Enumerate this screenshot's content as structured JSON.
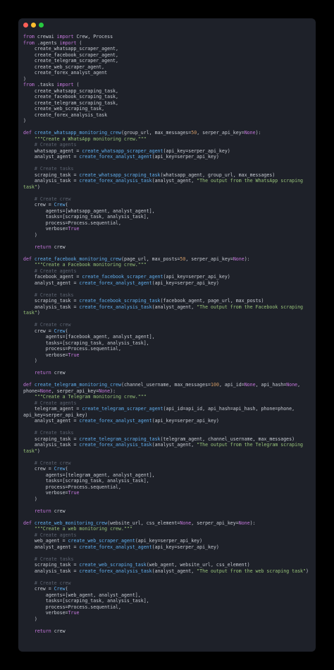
{
  "window": {
    "buttons": [
      {
        "name": "close",
        "color": "#ff5f56"
      },
      {
        "name": "minimize",
        "color": "#ffbd2e"
      },
      {
        "name": "maximize",
        "color": "#27c93f"
      }
    ]
  },
  "theme": {
    "background": "#1e2129",
    "page_background": "#000000",
    "keyword": "#c678dd",
    "function": "#61afef",
    "string": "#98c379",
    "number": "#d19a66",
    "comment": "#5c6370",
    "plain": "#c6cad2"
  },
  "code_lines": [
    [
      [
        "kw",
        "from"
      ],
      [
        "pl",
        " crewai "
      ],
      [
        "kw",
        "import"
      ],
      [
        "pl",
        " Crew, Process"
      ]
    ],
    [
      [
        "kw",
        "from"
      ],
      [
        "pl",
        " .agents "
      ],
      [
        "kw",
        "import"
      ],
      [
        "pl",
        " ("
      ]
    ],
    [
      [
        "pl",
        "    create_whatsapp_scraper_agent,"
      ]
    ],
    [
      [
        "pl",
        "    create_facebook_scraper_agent,"
      ]
    ],
    [
      [
        "pl",
        "    create_telegram_scraper_agent,"
      ]
    ],
    [
      [
        "pl",
        "    create_web_scraper_agent,"
      ]
    ],
    [
      [
        "pl",
        "    create_forex_analyst_agent"
      ]
    ],
    [
      [
        "pl",
        ")"
      ]
    ],
    [
      [
        "kw",
        "from"
      ],
      [
        "pl",
        " .tasks "
      ],
      [
        "kw",
        "import"
      ],
      [
        "pl",
        " ("
      ]
    ],
    [
      [
        "pl",
        "    create_whatsapp_scraping_task,"
      ]
    ],
    [
      [
        "pl",
        "    create_facebook_scraping_task,"
      ]
    ],
    [
      [
        "pl",
        "    create_telegram_scraping_task,"
      ]
    ],
    [
      [
        "pl",
        "    create_web_scraping_task,"
      ]
    ],
    [
      [
        "pl",
        "    create_forex_analysis_task"
      ]
    ],
    [
      [
        "pl",
        ")"
      ]
    ],
    [],
    [
      [
        "kw",
        "def"
      ],
      [
        "pl",
        " "
      ],
      [
        "fn",
        "create_whatsapp_monitoring_crew"
      ],
      [
        "pl",
        "(group_url, max_messages="
      ],
      [
        "num",
        "50"
      ],
      [
        "pl",
        ", serper_api_key="
      ],
      [
        "kw",
        "None"
      ],
      [
        "pl",
        "):"
      ]
    ],
    [
      [
        "pl",
        "    "
      ],
      [
        "str",
        "\"\"\"Create a WhatsApp monitoring crew.\"\"\""
      ]
    ],
    [
      [
        "pl",
        "    "
      ],
      [
        "cm",
        "# Create agents"
      ]
    ],
    [
      [
        "pl",
        "    whatsapp_agent = "
      ],
      [
        "fn",
        "create_whatsapp_scraper_agent"
      ],
      [
        "pl",
        "(api_key=serper_api_key)"
      ]
    ],
    [
      [
        "pl",
        "    analyst_agent = "
      ],
      [
        "fn",
        "create_forex_analyst_agent"
      ],
      [
        "pl",
        "(api_key=serper_api_key)"
      ]
    ],
    [],
    [
      [
        "pl",
        "    "
      ],
      [
        "cm",
        "# Create tasks"
      ]
    ],
    [
      [
        "pl",
        "    scraping_task = "
      ],
      [
        "fn",
        "create_whatsapp_scraping_task"
      ],
      [
        "pl",
        "(whatsapp_agent, group_url, max_messages)"
      ]
    ],
    [
      [
        "pl",
        "    analysis_task = "
      ],
      [
        "fn",
        "create_forex_analysis_task"
      ],
      [
        "pl",
        "(analyst_agent, "
      ],
      [
        "str",
        "\"The output from the WhatsApp scraping"
      ]
    ],
    [
      [
        "str",
        "task\""
      ],
      [
        "pl",
        ")"
      ]
    ],
    [],
    [
      [
        "pl",
        "    "
      ],
      [
        "cm",
        "# Create crew"
      ]
    ],
    [
      [
        "pl",
        "    crew = "
      ],
      [
        "fn",
        "Crew"
      ],
      [
        "pl",
        "("
      ]
    ],
    [
      [
        "pl",
        "        agents=[whatsapp_agent, analyst_agent],"
      ]
    ],
    [
      [
        "pl",
        "        tasks=[scraping_task, analysis_task],"
      ]
    ],
    [
      [
        "pl",
        "        process=Process.sequential,"
      ]
    ],
    [
      [
        "pl",
        "        verbose="
      ],
      [
        "kw",
        "True"
      ]
    ],
    [
      [
        "pl",
        "    )"
      ]
    ],
    [],
    [
      [
        "pl",
        "    "
      ],
      [
        "kw",
        "return"
      ],
      [
        "pl",
        " crew"
      ]
    ],
    [],
    [
      [
        "kw",
        "def"
      ],
      [
        "pl",
        " "
      ],
      [
        "fn",
        "create_facebook_monitoring_crew"
      ],
      [
        "pl",
        "(page_url, max_posts="
      ],
      [
        "num",
        "50"
      ],
      [
        "pl",
        ", serper_api_key="
      ],
      [
        "kw",
        "None"
      ],
      [
        "pl",
        "):"
      ]
    ],
    [
      [
        "pl",
        "    "
      ],
      [
        "str",
        "\"\"\"Create a Facebook monitoring crew.\"\"\""
      ]
    ],
    [
      [
        "pl",
        "    "
      ],
      [
        "cm",
        "# Create agents"
      ]
    ],
    [
      [
        "pl",
        "    facebook_agent = "
      ],
      [
        "fn",
        "create_facebook_scraper_agent"
      ],
      [
        "pl",
        "(api_key=serper_api_key)"
      ]
    ],
    [
      [
        "pl",
        "    analyst_agent = "
      ],
      [
        "fn",
        "create_forex_analyst_agent"
      ],
      [
        "pl",
        "(api_key=serper_api_key)"
      ]
    ],
    [],
    [
      [
        "pl",
        "    "
      ],
      [
        "cm",
        "# Create tasks"
      ]
    ],
    [
      [
        "pl",
        "    scraping_task = "
      ],
      [
        "fn",
        "create_facebook_scraping_task"
      ],
      [
        "pl",
        "(facebook_agent, page_url, max_posts)"
      ]
    ],
    [
      [
        "pl",
        "    analysis_task = "
      ],
      [
        "fn",
        "create_forex_analysis_task"
      ],
      [
        "pl",
        "(analyst_agent, "
      ],
      [
        "str",
        "\"The output from the Facebook scraping"
      ]
    ],
    [
      [
        "str",
        "task\""
      ],
      [
        "pl",
        ")"
      ]
    ],
    [],
    [
      [
        "pl",
        "    "
      ],
      [
        "cm",
        "# Create crew"
      ]
    ],
    [
      [
        "pl",
        "    crew = "
      ],
      [
        "fn",
        "Crew"
      ],
      [
        "pl",
        "("
      ]
    ],
    [
      [
        "pl",
        "        agents=[facebook_agent, analyst_agent],"
      ]
    ],
    [
      [
        "pl",
        "        tasks=[scraping_task, analysis_task],"
      ]
    ],
    [
      [
        "pl",
        "        process=Process.sequential,"
      ]
    ],
    [
      [
        "pl",
        "        verbose="
      ],
      [
        "kw",
        "True"
      ]
    ],
    [
      [
        "pl",
        "    )"
      ]
    ],
    [],
    [
      [
        "pl",
        "    "
      ],
      [
        "kw",
        "return"
      ],
      [
        "pl",
        " crew"
      ]
    ],
    [],
    [
      [
        "kw",
        "def"
      ],
      [
        "pl",
        " "
      ],
      [
        "fn",
        "create_telegram_monitoring_crew"
      ],
      [
        "pl",
        "(channel_username, max_messages="
      ],
      [
        "num",
        "100"
      ],
      [
        "pl",
        ", api_id="
      ],
      [
        "kw",
        "None"
      ],
      [
        "pl",
        ", api_hash="
      ],
      [
        "kw",
        "None"
      ],
      [
        "pl",
        ","
      ]
    ],
    [
      [
        "pl",
        "phone="
      ],
      [
        "kw",
        "None"
      ],
      [
        "pl",
        ", serper_api_key="
      ],
      [
        "kw",
        "None"
      ],
      [
        "pl",
        "):"
      ]
    ],
    [
      [
        "pl",
        "    "
      ],
      [
        "str",
        "\"\"\"Create a Telegram monitoring crew.\"\"\""
      ]
    ],
    [
      [
        "pl",
        "    "
      ],
      [
        "cm",
        "# Create agents"
      ]
    ],
    [
      [
        "pl",
        "    telegram_agent = "
      ],
      [
        "fn",
        "create_telegram_scraper_agent"
      ],
      [
        "pl",
        "(api_id=api_id, api_hash=api_hash, phone=phone,"
      ]
    ],
    [
      [
        "pl",
        "api_key=serper_api_key)"
      ]
    ],
    [
      [
        "pl",
        "    analyst_agent = "
      ],
      [
        "fn",
        "create_forex_analyst_agent"
      ],
      [
        "pl",
        "(api_key=serper_api_key)"
      ]
    ],
    [],
    [
      [
        "pl",
        "    "
      ],
      [
        "cm",
        "# Create tasks"
      ]
    ],
    [
      [
        "pl",
        "    scraping_task = "
      ],
      [
        "fn",
        "create_telegram_scraping_task"
      ],
      [
        "pl",
        "(telegram_agent, channel_username, max_messages)"
      ]
    ],
    [
      [
        "pl",
        "    analysis_task = "
      ],
      [
        "fn",
        "create_forex_analysis_task"
      ],
      [
        "pl",
        "(analyst_agent, "
      ],
      [
        "str",
        "\"The output from the Telegram scraping"
      ]
    ],
    [
      [
        "str",
        "task\""
      ],
      [
        "pl",
        ")"
      ]
    ],
    [],
    [
      [
        "pl",
        "    "
      ],
      [
        "cm",
        "# Create crew"
      ]
    ],
    [
      [
        "pl",
        "    crew = "
      ],
      [
        "fn",
        "Crew"
      ],
      [
        "pl",
        "("
      ]
    ],
    [
      [
        "pl",
        "        agents=[telegram_agent, analyst_agent],"
      ]
    ],
    [
      [
        "pl",
        "        tasks=[scraping_task, analysis_task],"
      ]
    ],
    [
      [
        "pl",
        "        process=Process.sequential,"
      ]
    ],
    [
      [
        "pl",
        "        verbose="
      ],
      [
        "kw",
        "True"
      ]
    ],
    [
      [
        "pl",
        "    )"
      ]
    ],
    [],
    [
      [
        "pl",
        "    "
      ],
      [
        "kw",
        "return"
      ],
      [
        "pl",
        " crew"
      ]
    ],
    [],
    [
      [
        "kw",
        "def"
      ],
      [
        "pl",
        " "
      ],
      [
        "fn",
        "create_web_monitoring_crew"
      ],
      [
        "pl",
        "(website_url, css_element="
      ],
      [
        "kw",
        "None"
      ],
      [
        "pl",
        ", serper_api_key="
      ],
      [
        "kw",
        "None"
      ],
      [
        "pl",
        "):"
      ]
    ],
    [
      [
        "pl",
        "    "
      ],
      [
        "str",
        "\"\"\"Create a web monitoring crew.\"\"\""
      ]
    ],
    [
      [
        "pl",
        "    "
      ],
      [
        "cm",
        "# Create agents"
      ]
    ],
    [
      [
        "pl",
        "    web_agent = "
      ],
      [
        "fn",
        "create_web_scraper_agent"
      ],
      [
        "pl",
        "(api_key=serper_api_key)"
      ]
    ],
    [
      [
        "pl",
        "    analyst_agent = "
      ],
      [
        "fn",
        "create_forex_analyst_agent"
      ],
      [
        "pl",
        "(api_key=serper_api_key)"
      ]
    ],
    [],
    [
      [
        "pl",
        "    "
      ],
      [
        "cm",
        "# Create tasks"
      ]
    ],
    [
      [
        "pl",
        "    scraping_task = "
      ],
      [
        "fn",
        "create_web_scraping_task"
      ],
      [
        "pl",
        "(web_agent, website_url, css_element)"
      ]
    ],
    [
      [
        "pl",
        "    analysis_task = "
      ],
      [
        "fn",
        "create_forex_analysis_task"
      ],
      [
        "pl",
        "(analyst_agent, "
      ],
      [
        "str",
        "\"The output from the web scraping task\""
      ],
      [
        "pl",
        ")"
      ]
    ],
    [],
    [
      [
        "pl",
        "    "
      ],
      [
        "cm",
        "# Create crew"
      ]
    ],
    [
      [
        "pl",
        "    crew = "
      ],
      [
        "fn",
        "Crew"
      ],
      [
        "pl",
        "("
      ]
    ],
    [
      [
        "pl",
        "        agents=[web_agent, analyst_agent],"
      ]
    ],
    [
      [
        "pl",
        "        tasks=[scraping_task, analysis_task],"
      ]
    ],
    [
      [
        "pl",
        "        process=Process.sequential,"
      ]
    ],
    [
      [
        "pl",
        "        verbose="
      ],
      [
        "kw",
        "True"
      ]
    ],
    [
      [
        "pl",
        "    )"
      ]
    ],
    [],
    [
      [
        "pl",
        "    "
      ],
      [
        "kw",
        "return"
      ],
      [
        "pl",
        " crew"
      ]
    ]
  ]
}
